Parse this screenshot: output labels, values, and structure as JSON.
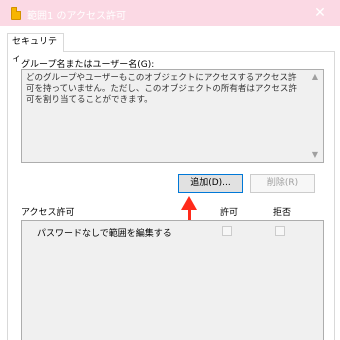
{
  "window": {
    "title": "範囲1 のアクセス許可",
    "close_label": "✕"
  },
  "tabs": [
    {
      "label": "セキュリティ"
    }
  ],
  "group": {
    "label": "グループ名またはユーザー名(G):",
    "message": "どのグループやユーザーもこのオブジェクトにアクセスするアクセス許可を持っていません。ただし、このオブジェクトの所有者はアクセス許可を割り当てることができます。"
  },
  "buttons": {
    "add": "追加(D)...",
    "remove": "削除(R)"
  },
  "permissions": {
    "header": "アクセス許可",
    "allow": "許可",
    "deny": "拒否",
    "rows": [
      {
        "label": "パスワードなしで範囲を編集する",
        "allow": false,
        "deny": false
      }
    ]
  },
  "colors": {
    "titlebar": "#fbd9e4",
    "accent": "#0078d7",
    "arrow": "#ff2a1a"
  },
  "icons": {
    "title": "document-icon",
    "close": "close-icon",
    "annotation": "red-arrow-icon"
  }
}
